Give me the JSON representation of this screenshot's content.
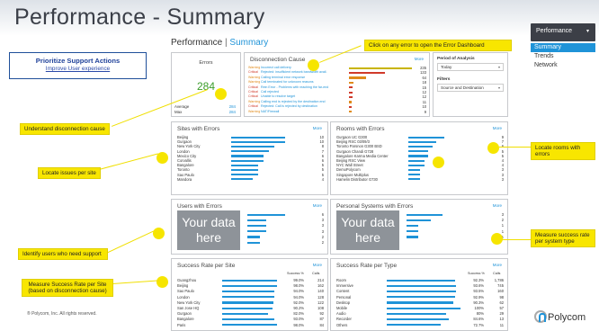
{
  "page": {
    "title": "Performance - Summary"
  },
  "heading": {
    "main": "Performance",
    "sep": " | ",
    "sub": "Summary"
  },
  "nav": {
    "dropdown_label": "Performance",
    "dropdown_caret": "▾",
    "items": [
      {
        "label": "Summary",
        "active": true
      },
      {
        "label": "Trends",
        "active": false
      },
      {
        "label": "Network",
        "active": false
      }
    ]
  },
  "priority": {
    "title": "Prioritize Support Actions",
    "link": "Improve User experience"
  },
  "errors_card": {
    "title": "Errors",
    "value": "284",
    "average_label": "Average",
    "average_value": "284",
    "max_label": "Max",
    "max_value": "284"
  },
  "disconnection": {
    "title": "Disconnection Cause",
    "more": "More",
    "rows": [
      {
        "severity": "Warning",
        "label": "Incorrect call delivery",
        "value": "235"
      },
      {
        "severity": "Critical",
        "label": "Rejected: insufficient network bandwidth avail.",
        "value": "133"
      },
      {
        "severity": "Warning",
        "label": "Calling terminal error response",
        "value": "64"
      },
      {
        "severity": "Warning",
        "label": "Call terminated for unknown reasons",
        "value": "18"
      },
      {
        "severity": "Critical",
        "label": "Rein Error - Problems with reaching the far-end",
        "value": "15"
      },
      {
        "severity": "Critical",
        "label": "Call rejected",
        "value": "12"
      },
      {
        "severity": "Critical",
        "label": "Unable to resolve target",
        "value": "12"
      },
      {
        "severity": "Warning",
        "label": "Calling end is rejected by the destination end",
        "value": "11"
      },
      {
        "severity": "Critical",
        "label": "Rejected: Call is rejected by destination",
        "value": "10"
      },
      {
        "severity": "Warning",
        "label": "NAT/Firewall",
        "value": "9"
      }
    ]
  },
  "period": {
    "title": "Period of Analysis",
    "value": "Today",
    "filters_title": "Filters",
    "filter_value": "Source and Destination",
    "caret": "▾"
  },
  "sites_errors": {
    "title": "Sites with Errors",
    "more": "More",
    "rows": [
      {
        "label": "Beijing",
        "value": "10"
      },
      {
        "label": "Gurgaon",
        "value": "10"
      },
      {
        "label": "New York City",
        "value": "8"
      },
      {
        "label": "London",
        "value": "7"
      },
      {
        "label": "Mexico City",
        "value": "6"
      },
      {
        "label": "Corvallis",
        "value": "6"
      },
      {
        "label": "Bangalore",
        "value": "5"
      },
      {
        "label": "Toronto",
        "value": "5"
      },
      {
        "label": "Sao Paulo",
        "value": "5"
      },
      {
        "label": "Mandora",
        "value": "4"
      }
    ]
  },
  "rooms_errors": {
    "title": "Rooms with Errors",
    "more": "More",
    "rows": [
      {
        "label": "Gurgaon UC G300",
        "value": "9"
      },
      {
        "label": "Beijing RSC 03/09/3",
        "value": "7"
      },
      {
        "label": "Toronto Parsnon G300 BSD",
        "value": "6"
      },
      {
        "label": "Gurgaon Chandi G728",
        "value": "5"
      },
      {
        "label": "Bangalore Karma Media Center",
        "value": "5"
      },
      {
        "label": "Beijing RSC View",
        "value": "4"
      },
      {
        "label": "NYC Wall Street",
        "value": "4"
      },
      {
        "label": "DemoPolycom",
        "value": "3"
      },
      {
        "label": "Singapore Multiplus",
        "value": "3"
      },
      {
        "label": "Hamelin Distributor G730",
        "value": "3"
      }
    ]
  },
  "users_errors": {
    "title": "Users with Errors",
    "more": "More",
    "placeholder": [
      "Your data",
      "here"
    ],
    "values": [
      "6",
      "3",
      "3",
      "3",
      "2",
      "2"
    ]
  },
  "personal_systems": {
    "title": "Personal Systems with Errors",
    "more": "More",
    "placeholder": [
      "Your data",
      "here"
    ],
    "values": [
      "3",
      "2",
      "1",
      "1",
      "1"
    ]
  },
  "success_site": {
    "title": "Success Rate per Site",
    "more": "More",
    "col_success": "Success %",
    "col_calls": "Calls",
    "rows": [
      {
        "label": "Guangzhou",
        "success": "99.0%",
        "calls": "214",
        "fill": 0.99
      },
      {
        "label": "Beijing",
        "success": "98.0%",
        "calls": "162",
        "fill": 0.98
      },
      {
        "label": "Sao Paulo",
        "success": "94.0%",
        "calls": "140",
        "fill": 0.94
      },
      {
        "label": "London",
        "success": "94.0%",
        "calls": "128",
        "fill": 0.94
      },
      {
        "label": "New York City",
        "success": "92.0%",
        "calls": "122",
        "fill": 0.92
      },
      {
        "label": "San Jose HQ",
        "success": "90.2%",
        "calls": "108",
        "fill": 0.902
      },
      {
        "label": "Gurgaon",
        "success": "82.0%",
        "calls": "92",
        "fill": 0.82
      },
      {
        "label": "Bangalore",
        "success": "93.0%",
        "calls": "87",
        "fill": 0.93
      },
      {
        "label": "Paris",
        "success": "98.0%",
        "calls": "84",
        "fill": 0.98
      }
    ]
  },
  "success_type": {
    "title": "Success Rate per Type",
    "more": "More",
    "col_success": "Success %",
    "col_calls": "Calls",
    "rows": [
      {
        "label": "Room",
        "success": "92.3%",
        "calls": "1,786",
        "fill": 0.923
      },
      {
        "label": "Immersive",
        "success": "93.6%",
        "calls": "745",
        "fill": 0.936
      },
      {
        "label": "Content",
        "success": "93.5%",
        "calls": "160",
        "fill": 0.935
      },
      {
        "label": "Personal",
        "success": "92.9%",
        "calls": "98",
        "fill": 0.929
      },
      {
        "label": "Desktop",
        "success": "90.3%",
        "calls": "62",
        "fill": 0.903
      },
      {
        "label": "Mobile",
        "success": "100%",
        "calls": "57",
        "fill": 1.0
      },
      {
        "label": "Audio",
        "success": "80%",
        "calls": "29",
        "fill": 0.8
      },
      {
        "label": "Recorder",
        "success": "84.6%",
        "calls": "13",
        "fill": 0.846
      },
      {
        "label": "Others",
        "success": "72.7%",
        "calls": "11",
        "fill": 0.727
      }
    ]
  },
  "callouts": {
    "click_error": "Click on any error to open the Error Dashboard",
    "disconnection": "Understand disconnection cause",
    "issues_site": "Locate issues per site",
    "rooms": "Locate rooms with errors",
    "users": "Identify users who need support",
    "measure_site_1": "Measure Success Rate per Site",
    "measure_site_2": "(based on disconnection cause)",
    "measure_type_1": "Measure success rate",
    "measure_type_2": "per system type"
  },
  "footer": {
    "copyright": "® Polycom, Inc. All rights reserved.",
    "logo": "Polycom"
  },
  "colors": {
    "accent": "#1f93d8",
    "callout": "#f8e600",
    "critical": "#d03a2a",
    "warning": "#e08a1a"
  }
}
